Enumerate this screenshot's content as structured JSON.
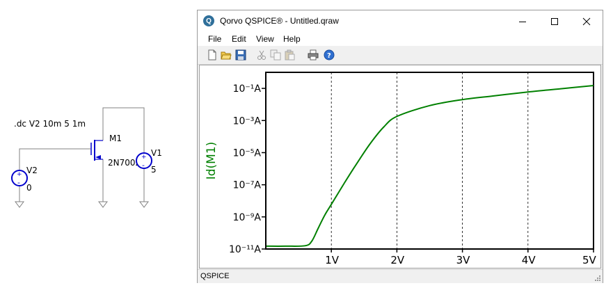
{
  "schematic": {
    "directive": ".dc V2 10m 5 1m",
    "m1_name": "M1",
    "m1_model": "2N7002",
    "v1_name": "V1",
    "v1_value": "5",
    "v2_name": "V2",
    "v2_value": "0"
  },
  "window": {
    "icon_letter": "Q",
    "title": "Qorvo QSPICE® - Untitled.qraw"
  },
  "menu": [
    "File",
    "Edit",
    "View",
    "Help"
  ],
  "toolbar": [
    "new-file-icon",
    "open-folder-icon",
    "save-icon",
    "cut-icon",
    "copy-icon",
    "paste-icon",
    "print-icon",
    "help-icon"
  ],
  "status": {
    "text": "QSPICE"
  },
  "colors": {
    "trace": "#008000",
    "ylabel": "#008000",
    "accent": "#2f6f9a"
  },
  "chart_data": {
    "type": "line",
    "xlabel": "",
    "ylabel": "Id(M1)",
    "xscale": "linear",
    "yscale": "log",
    "xlim": [
      0.01,
      5
    ],
    "ylim": [
      1e-11,
      1
    ],
    "grid": "vertical dashed",
    "xticks": [
      {
        "value": 1,
        "label": "1V"
      },
      {
        "value": 2,
        "label": "2V"
      },
      {
        "value": 3,
        "label": "3V"
      },
      {
        "value": 4,
        "label": "4V"
      },
      {
        "value": 5,
        "label": "5V"
      }
    ],
    "yticks": [
      {
        "value": 1e-11,
        "label": "10⁻¹¹A"
      },
      {
        "value": 1e-09,
        "label": "10⁻⁹A"
      },
      {
        "value": 1e-07,
        "label": "10⁻⁷A"
      },
      {
        "value": 1e-05,
        "label": "10⁻⁵A"
      },
      {
        "value": 0.001,
        "label": "10⁻³A"
      },
      {
        "value": 0.1,
        "label": "10⁻¹A"
      }
    ],
    "series": [
      {
        "x": [
          0.01,
          0.3,
          0.6,
          0.7,
          0.8,
          0.9,
          1.0,
          1.2,
          1.4,
          1.6,
          1.8,
          2.0,
          2.5,
          3.0,
          3.5,
          4.0,
          4.5,
          5.0
        ],
        "y": [
          1.5e-11,
          1.5e-11,
          1.6e-11,
          3e-11,
          2e-10,
          1.3e-09,
          6e-09,
          1.3e-07,
          2.5e-06,
          4e-05,
          0.0004,
          0.0018,
          0.0085,
          0.02,
          0.035,
          0.06,
          0.095,
          0.15
        ]
      }
    ]
  }
}
